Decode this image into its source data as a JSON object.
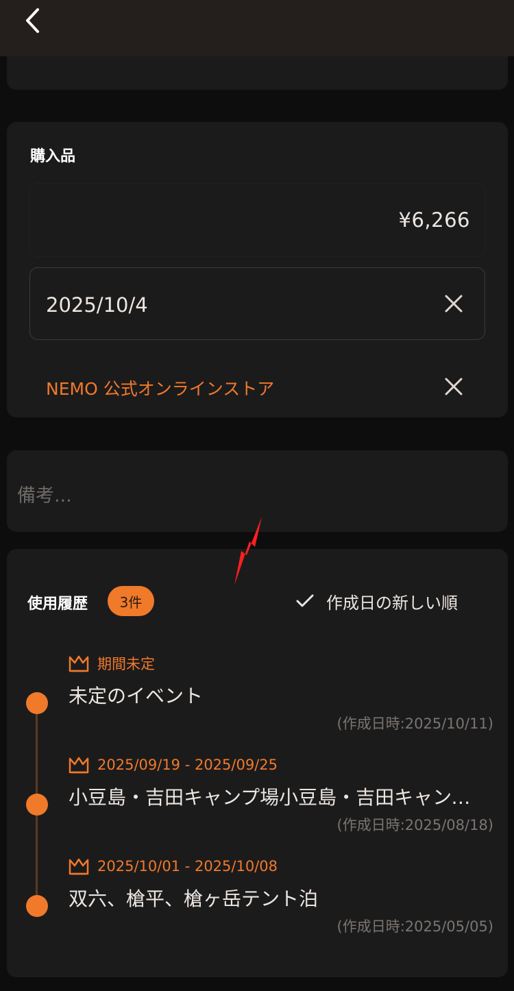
{
  "purchase": {
    "label": "購入品",
    "price": "¥6,266",
    "date": "2025/10/4",
    "store": "NEMO 公式オンラインストア"
  },
  "memo": {
    "placeholder": "備考..."
  },
  "history": {
    "label": "使用履歴",
    "count_badge": "3件",
    "sort_label": "作成日の新しい順",
    "entries": [
      {
        "period": "期間未定",
        "title": "未定のイベント",
        "created": "(作成日時:2025/10/11)"
      },
      {
        "period": "2025/09/19 - 2025/09/25",
        "title": "小豆島・吉田キャンプ場小豆島・吉田キャンプ場",
        "created": "(作成日時:2025/08/18)"
      },
      {
        "period": "2025/10/01 - 2025/10/08",
        "title": "双六、槍平、槍ヶ岳テント泊",
        "created": "(作成日時:2025/05/05)"
      }
    ]
  },
  "colors": {
    "accent": "#f07a2a",
    "card": "#1c1b1c",
    "background": "#0d0d0d",
    "topbar": "#241f1d"
  },
  "icons": {
    "back": "chevron-left-icon",
    "clear": "close-icon",
    "sort": "check-icon",
    "event": "crown-icon",
    "annotation": "red-arrow-icon"
  }
}
